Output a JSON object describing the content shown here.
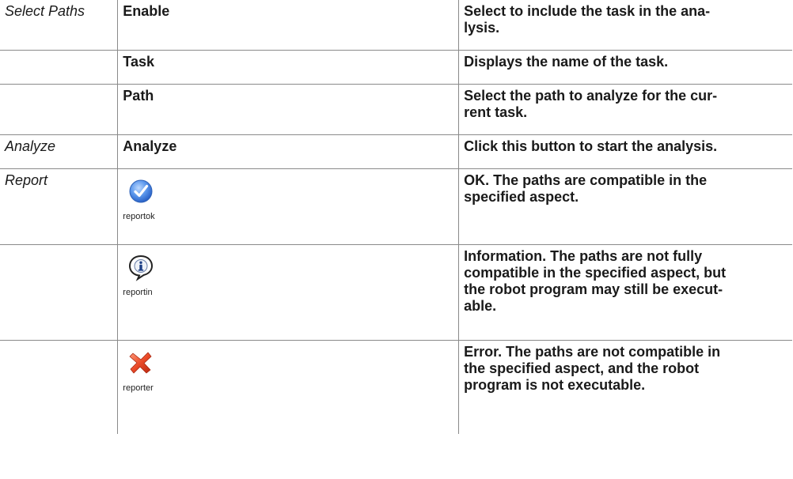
{
  "rows": [
    {
      "section": "Select Paths",
      "item": "Enable",
      "description": "Select to include the task in the ana-\nlysis."
    },
    {
      "section": "",
      "item": "Task",
      "description": "Displays the name of the task."
    },
    {
      "section": "",
      "item": "Path",
      "description": "Select the path to analyze for the cur-\nrent task."
    },
    {
      "section": "Analyze",
      "item": "Analyze",
      "description": "Click this button to start the analysis."
    },
    {
      "section": "Report",
      "icon": "check-icon",
      "caption": "reportok",
      "description": "OK. The paths are compatible in the\nspecified aspect."
    },
    {
      "section": "",
      "icon": "info-icon",
      "caption": "reportin",
      "description": "Information. The paths are not fully\ncompatible in the specified aspect, but\nthe robot program may still be execut-\nable."
    },
    {
      "section": "",
      "icon": "error-x-icon",
      "caption": "reporter",
      "description": "Error. The paths are not compatible in\nthe specified aspect, and the robot\nprogram is not executable."
    }
  ],
  "colors": {
    "check_blue": "#3d7fe0",
    "error_red": "#e4472a",
    "border": "#8a8a8a"
  }
}
